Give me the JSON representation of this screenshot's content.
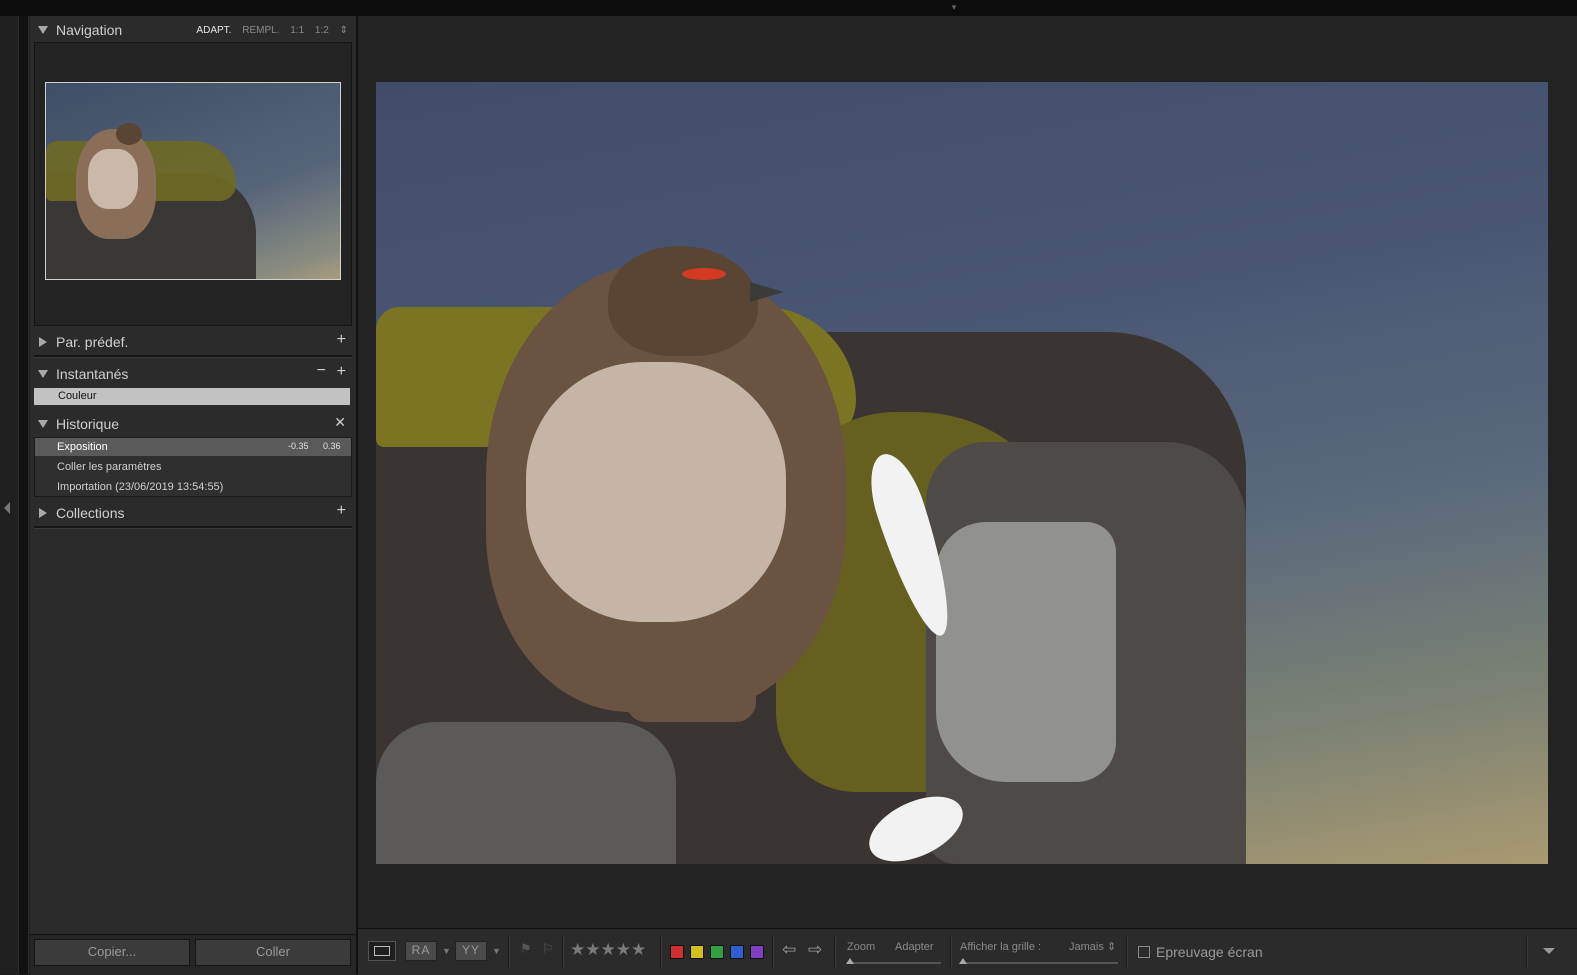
{
  "navigator": {
    "title": "Navigation",
    "options": [
      "ADAPT.",
      "REMPL.",
      "1:1",
      "1:2"
    ],
    "active_option": "ADAPT."
  },
  "presets": {
    "title": "Par. prédef."
  },
  "snapshots": {
    "title": "Instantanés",
    "items": [
      "Couleur"
    ]
  },
  "history": {
    "title": "Historique",
    "items": [
      {
        "label": "Exposition",
        "before": "-0.35",
        "after": "0.36",
        "selected": true
      },
      {
        "label": "Coller les paramètres",
        "before": "",
        "after": "",
        "selected": false
      },
      {
        "label": "Importation (23/06/2019 13:54:55)",
        "before": "",
        "after": "",
        "selected": false
      }
    ]
  },
  "collections": {
    "title": "Collections"
  },
  "buttons": {
    "copy": "Copier...",
    "paste": "Coller"
  },
  "toolbar": {
    "compare_label": "RA",
    "survey_label": "YY",
    "zoom_label": "Zoom",
    "zoom_value": "Adapter",
    "grid_label": "Afficher la grille :",
    "grid_value": "Jamais",
    "proof_label": "Epreuvage écran",
    "rating_stars": 5,
    "color_labels": [
      "#d03030",
      "#d0c020",
      "#30a040",
      "#3060d0",
      "#8040c0"
    ]
  }
}
